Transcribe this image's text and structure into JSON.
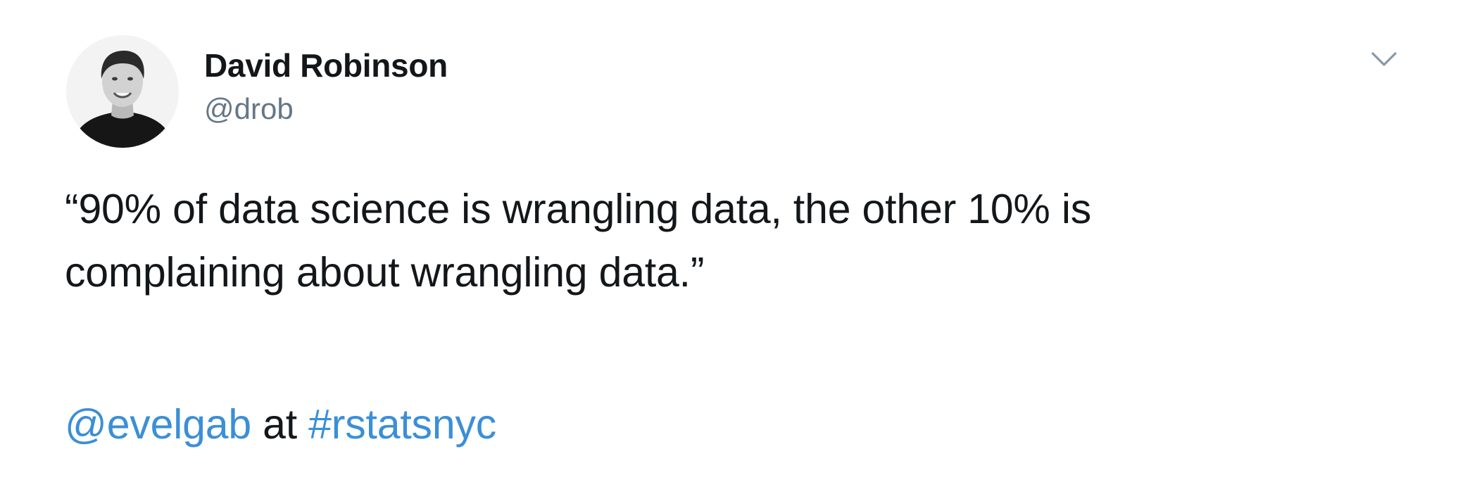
{
  "author": {
    "name": "David Robinson",
    "handle": "@drob"
  },
  "tweet": {
    "text": "“90% of data science is wrangling data, the other 10% is\ncomplaining about wrangling data.”",
    "mention": "@evelgab",
    "connector": " at ",
    "hashtag": "#rstatsnyc"
  },
  "icons": {
    "menu": "chevron-down-icon",
    "avatar": "profile-photo"
  },
  "colors": {
    "link": "#3b8fd6",
    "handle": "#657786",
    "text": "#14171a"
  }
}
